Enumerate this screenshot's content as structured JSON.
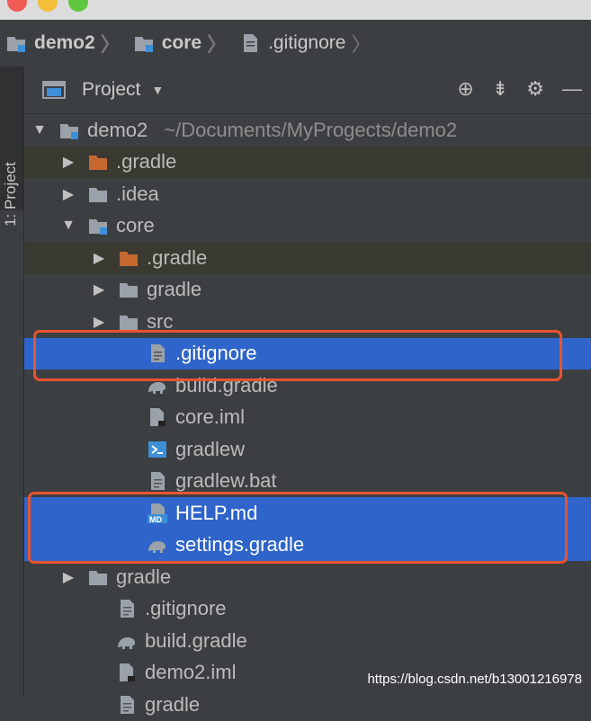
{
  "breadcrumb": {
    "items": [
      "demo2",
      "core",
      ".gitignore"
    ]
  },
  "left_strip": {
    "label": "1: Project"
  },
  "panel": {
    "title": "Project"
  },
  "tree": [
    {
      "label": "demo2",
      "sub": "~/Documents/MyProgects/demo2",
      "icon": "module-folder-icon",
      "arrow": "down"
    },
    {
      "label": ".gradle",
      "icon": "orange-folder-icon",
      "arrow": "right"
    },
    {
      "label": ".idea",
      "icon": "folder-icon",
      "arrow": "right"
    },
    {
      "label": "core",
      "icon": "module-folder-icon",
      "arrow": "down"
    },
    {
      "label": ".gradle",
      "icon": "orange-folder-icon",
      "arrow": "right"
    },
    {
      "label": "gradle",
      "icon": "folder-icon",
      "arrow": "right"
    },
    {
      "label": "src",
      "icon": "folder-icon",
      "arrow": "right"
    },
    {
      "label": ".gitignore",
      "icon": "text-file-icon",
      "arrow": ""
    },
    {
      "label": "build.gradle",
      "icon": "gradle-elephant-icon",
      "arrow": ""
    },
    {
      "label": "core.iml",
      "icon": "iml-file-icon",
      "arrow": ""
    },
    {
      "label": "gradlew",
      "icon": "terminal-file-icon",
      "arrow": ""
    },
    {
      "label": "gradlew.bat",
      "icon": "text-file-icon",
      "arrow": ""
    },
    {
      "label": "HELP.md",
      "icon": "markdown-file-icon",
      "arrow": ""
    },
    {
      "label": "settings.gradle",
      "icon": "gradle-elephant-icon",
      "arrow": ""
    },
    {
      "label": "gradle",
      "icon": "folder-icon",
      "arrow": "right"
    },
    {
      "label": ".gitignore",
      "icon": "text-file-icon",
      "arrow": ""
    },
    {
      "label": "build.gradle",
      "icon": "gradle-elephant-icon",
      "arrow": ""
    },
    {
      "label": "demo2.iml",
      "icon": "iml-file-icon",
      "arrow": ""
    },
    {
      "label": "gradle",
      "icon": "text-file-icon",
      "arrow": ""
    }
  ],
  "watermark": "https://blog.csdn.net/b13001216978",
  "colors": {
    "selection": "#2f65ca",
    "highlight_box": "#e8542e",
    "background": "#3c3f41",
    "excluded_band": "#3b3a32"
  }
}
